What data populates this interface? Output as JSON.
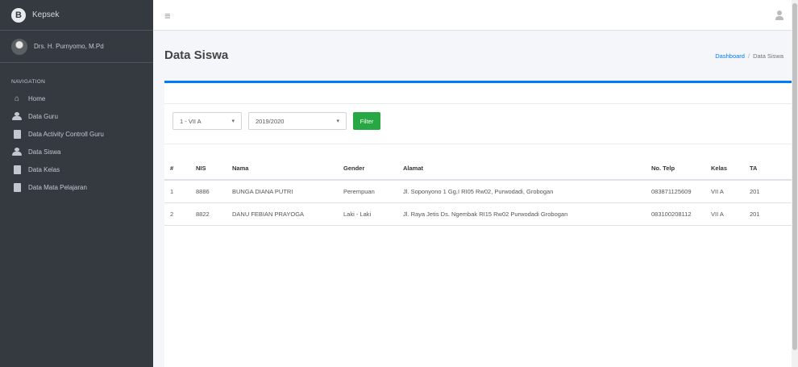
{
  "brand": {
    "logo_letter": "B",
    "name": "Kepsek"
  },
  "user": {
    "name": "Drs. H. Purnyomo, M.Pd"
  },
  "nav": {
    "header": "NAVIGATION",
    "items": [
      {
        "label": "Home",
        "icon": "home-icon"
      },
      {
        "label": "Data Guru",
        "icon": "users-icon"
      },
      {
        "label": "Data Activity Controll Guru",
        "icon": "book-icon"
      },
      {
        "label": "Data Siswa",
        "icon": "users-icon"
      },
      {
        "label": "Data Kelas",
        "icon": "book-icon"
      },
      {
        "label": "Data Mata Pelajaran",
        "icon": "book-icon"
      }
    ]
  },
  "topbar": {
    "menu_icon": "≡"
  },
  "page": {
    "title": "Data Siswa",
    "breadcrumb": {
      "home": "Dashboard",
      "sep": "/",
      "current": "Data Siswa"
    }
  },
  "filters": {
    "kelas": "1 - VII A",
    "tahun_ajaran": "2019/2020",
    "caret": "▾",
    "button": "Filter"
  },
  "table": {
    "headers": [
      "#",
      "NIS",
      "Nama",
      "Gender",
      "Alamat",
      "No. Telp",
      "Kelas",
      "TA"
    ],
    "rows": [
      [
        "1",
        "8886",
        "BUNGA DIANA PUTRI",
        "Perempuan",
        "Jl. Soponyono 1 Gg.I RI05 Rw02, Purwodadi, Grobogan",
        "083871125609",
        "VII A",
        "201"
      ],
      [
        "2",
        "8822",
        "DANU FEBIAN PRAYOGA",
        "Laki - Laki",
        "Jl. Raya Jetis Ds. Ngembak RI15 Rw02 Purwodadi Grobogan",
        "083100208112",
        "VII A",
        "201"
      ]
    ]
  },
  "colors": {
    "sidebar": "#343a40",
    "primary": "#007bff",
    "success": "#28a745",
    "content_bg": "#f4f6f9"
  }
}
